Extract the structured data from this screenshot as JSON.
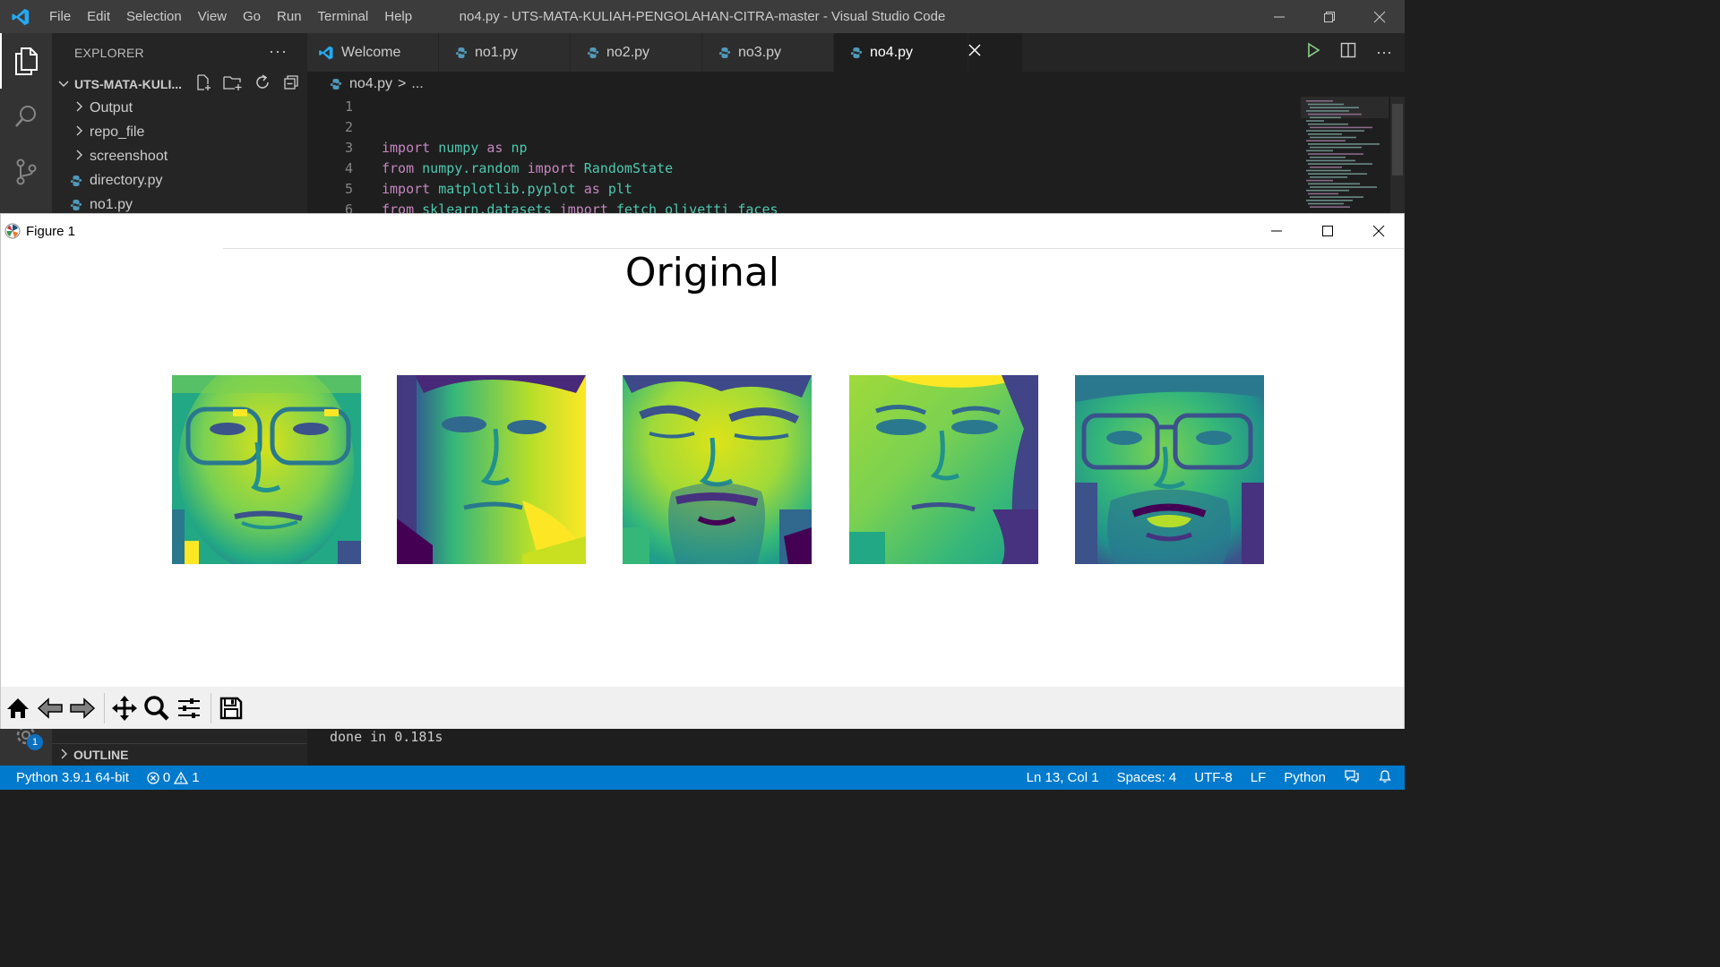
{
  "vscode": {
    "menu": [
      "File",
      "Edit",
      "Selection",
      "View",
      "Go",
      "Run",
      "Terminal",
      "Help"
    ],
    "window_title": "no4.py - UTS-MATA-KULIAH-PENGOLAHAN-CITRA-master - Visual Studio Code",
    "explorer_label": "EXPLORER",
    "explorer_more": "···",
    "folder_name": "UTS-MATA-KULI...",
    "tree": [
      {
        "label": "Output",
        "type": "folder"
      },
      {
        "label": "repo_file",
        "type": "folder"
      },
      {
        "label": "screenshoot",
        "type": "folder"
      },
      {
        "label": "directory.py",
        "type": "python-file"
      },
      {
        "label": "no1.py",
        "type": "python-file"
      }
    ],
    "outline_label": "OUTLINE",
    "tabs": [
      {
        "label": "Welcome",
        "icon": "vscode-icon",
        "active": false
      },
      {
        "label": "no1.py",
        "icon": "python-icon",
        "active": false
      },
      {
        "label": "no2.py",
        "icon": "python-icon",
        "active": false
      },
      {
        "label": "no3.py",
        "icon": "python-icon",
        "active": false
      },
      {
        "label": "no4.py",
        "icon": "python-icon",
        "active": true
      }
    ],
    "breadcrumb": {
      "file": "no4.py",
      "sep": ">",
      "rest": "..."
    },
    "code_lines": [
      {
        "n": "1",
        "tokens": []
      },
      {
        "n": "2",
        "tokens": []
      },
      {
        "n": "3",
        "tokens": [
          {
            "t": "import",
            "c": "kw"
          },
          {
            "t": " numpy ",
            "c": "mod"
          },
          {
            "t": "as",
            "c": "kw"
          },
          {
            "t": " np",
            "c": "mod"
          }
        ]
      },
      {
        "n": "4",
        "tokens": [
          {
            "t": "from",
            "c": "kw"
          },
          {
            "t": " numpy.random ",
            "c": "mod"
          },
          {
            "t": "import",
            "c": "kw"
          },
          {
            "t": " RandomState",
            "c": "mod"
          }
        ]
      },
      {
        "n": "5",
        "tokens": [
          {
            "t": "import",
            "c": "kw"
          },
          {
            "t": " matplotlib.pyplot ",
            "c": "mod"
          },
          {
            "t": "as",
            "c": "kw"
          },
          {
            "t": " plt",
            "c": "mod"
          }
        ]
      },
      {
        "n": "6",
        "tokens": [
          {
            "t": "from",
            "c": "kw"
          },
          {
            "t": " sklearn.datasets ",
            "c": "mod"
          },
          {
            "t": "import",
            "c": "kw"
          },
          {
            "t": " fetch_olivetti_faces",
            "c": "mod"
          }
        ]
      }
    ],
    "terminal_output": "done in 0.181s",
    "notification_count": "1",
    "status": {
      "python": "Python 3.9.1 64-bit",
      "errors": "0",
      "warnings": "1",
      "position": "Ln 13, Col 1",
      "spaces": "Spaces: 4",
      "encoding": "UTF-8",
      "eol": "LF",
      "language": "Python"
    },
    "colors": {
      "titlebar": "#3c3c3c",
      "activitybar": "#333333",
      "sidebar": "#252526",
      "editor": "#1e1e1e",
      "statusbar": "#007acc",
      "keyword": "#c586c0",
      "module": "#4ec9b0"
    }
  },
  "figure": {
    "window_title": "Figure 1",
    "suptitle": "Original",
    "faces": [
      {
        "desc": "face with glasses",
        "name": "face-1"
      },
      {
        "desc": "face tilted",
        "name": "face-2"
      },
      {
        "desc": "bearded face eyes closed",
        "name": "face-3"
      },
      {
        "desc": "face looking down",
        "name": "face-4"
      },
      {
        "desc": "bearded face with glasses",
        "name": "face-5"
      }
    ],
    "colormap": "viridis",
    "toolbar": [
      "home-icon",
      "back-icon",
      "forward-icon",
      "pan-icon",
      "zoom-icon",
      "configure-subplots-icon",
      "save-icon"
    ]
  }
}
